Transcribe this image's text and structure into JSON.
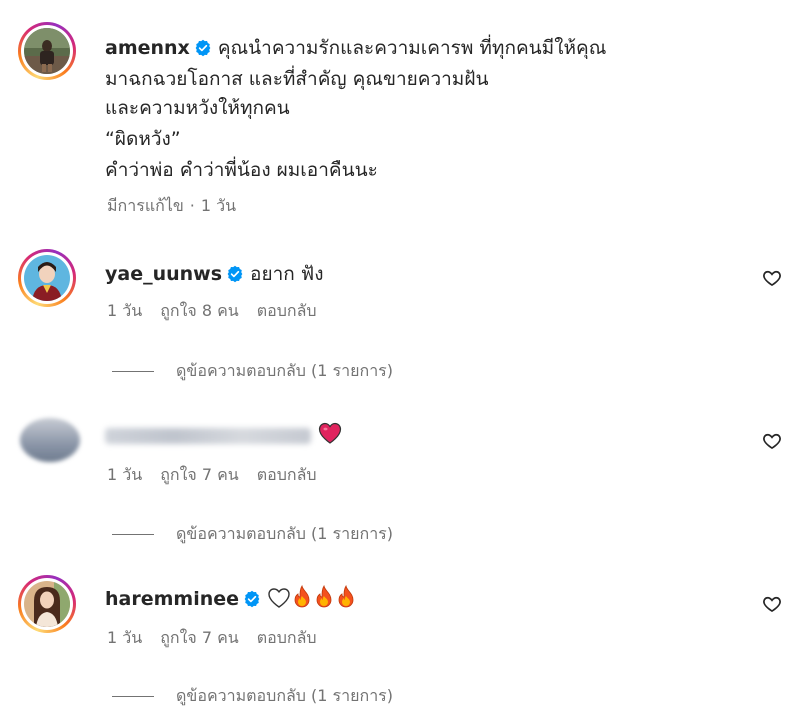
{
  "post": {
    "username": "amennx",
    "caption_lines": [
      "คุณนำความรักและความเคารพ ที่ทุกคนมีให้คุณ",
      "มาฉกฉวยโอกาส และที่สำคัญ คุณขายความฝัน",
      "และความหวังให้ทุกคน",
      "“ผิดหวัง”",
      "คำว่าพ่อ คำว่าพี่น้อง ผมเอาคืนนะ"
    ],
    "edited_label": "มีการแก้ไข",
    "time": "1 วัน"
  },
  "comments": [
    {
      "username": "yae_uunws",
      "text": "อยาก ฟัง",
      "time": "1 วัน",
      "likes": "ถูกใจ 8 คน",
      "reply_label": "ตอบกลับ",
      "view_replies": "ดูข้อความตอบกลับ (1 รายการ)"
    },
    {
      "username": "",
      "text": "",
      "time": "1 วัน",
      "likes": "ถูกใจ 7 คน",
      "reply_label": "ตอบกลับ",
      "view_replies": "ดูข้อความตอบกลับ (1 รายการ)"
    },
    {
      "username": "haremminee",
      "text": "",
      "time": "1 วัน",
      "likes": "ถูกใจ 7 คน",
      "reply_label": "ตอบกลับ",
      "view_replies": "ดูข้อความตอบกลับ (1 รายการ)"
    }
  ],
  "colors": {
    "verified_blue": "#0095f6",
    "meta_gray": "#737373",
    "text_dark": "#262626"
  },
  "icons": {
    "verified": "verified-badge-icon",
    "like": "heart-outline-icon",
    "emoji_heart_red": "red-heart-emoji",
    "emoji_heart_white": "white-heart-emoji",
    "emoji_fire": "fire-emoji"
  }
}
